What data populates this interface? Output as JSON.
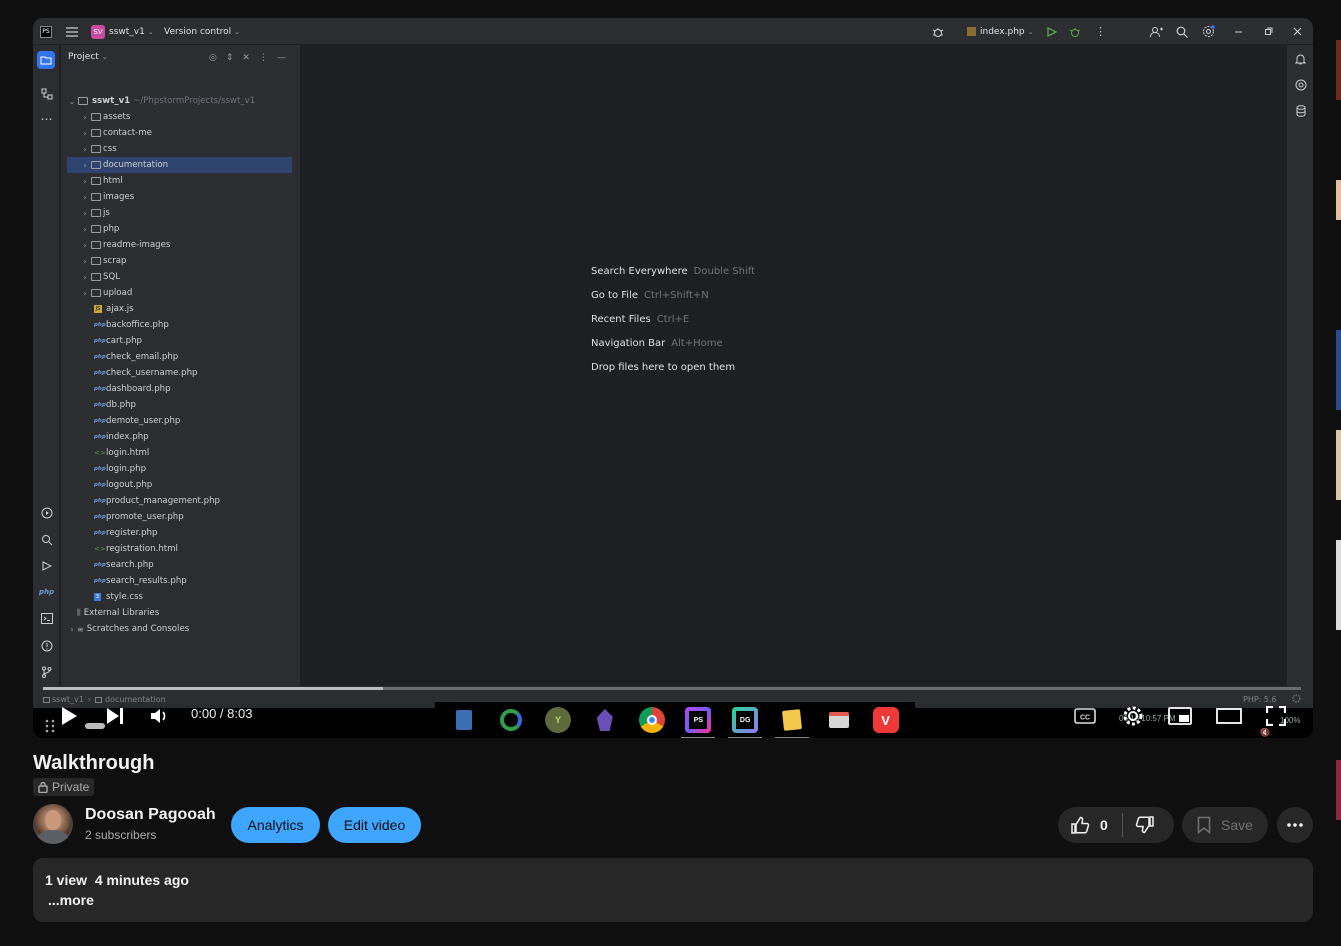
{
  "ide": {
    "project_badge": "SV",
    "project_name": "sswt_v1",
    "vcs_label": "Version control",
    "run_config": "index.php",
    "panel_title": "Project",
    "root_name": "sswt_v1",
    "root_path": "~/PhpstormProjects/sswt_v1",
    "folders": [
      "assets",
      "contact-me",
      "css",
      "documentation",
      "html",
      "images",
      "js",
      "php",
      "readme-images",
      "scrap",
      "SQL",
      "upload"
    ],
    "files": [
      {
        "name": "ajax.js",
        "type": "js"
      },
      {
        "name": "backoffice.php",
        "type": "php"
      },
      {
        "name": "cart.php",
        "type": "php"
      },
      {
        "name": "check_email.php",
        "type": "php"
      },
      {
        "name": "check_username.php",
        "type": "php"
      },
      {
        "name": "dashboard.php",
        "type": "php"
      },
      {
        "name": "db.php",
        "type": "php"
      },
      {
        "name": "demote_user.php",
        "type": "php"
      },
      {
        "name": "index.php",
        "type": "php"
      },
      {
        "name": "login.html",
        "type": "html"
      },
      {
        "name": "login.php",
        "type": "php"
      },
      {
        "name": "logout.php",
        "type": "php"
      },
      {
        "name": "product_management.php",
        "type": "php"
      },
      {
        "name": "promote_user.php",
        "type": "php"
      },
      {
        "name": "register.php",
        "type": "php"
      },
      {
        "name": "registration.html",
        "type": "html"
      },
      {
        "name": "search.php",
        "type": "php"
      },
      {
        "name": "search_results.php",
        "type": "php"
      },
      {
        "name": "style.css",
        "type": "css"
      }
    ],
    "external_libraries": "External Libraries",
    "scratches": "Scratches and Consoles",
    "hints": [
      {
        "label": "Search Everywhere",
        "keys": "Double Shift"
      },
      {
        "label": "Go to File",
        "keys": "Ctrl+Shift+N"
      },
      {
        "label": "Recent Files",
        "keys": "Ctrl+E"
      },
      {
        "label": "Navigation Bar",
        "keys": "Alt+Home"
      },
      {
        "label": "Drop files here to open them",
        "keys": ""
      }
    ],
    "breadcrumb_root": "sswt_v1",
    "breadcrumb_folder": "documentation",
    "php_version": "PHP: 5.6",
    "clock": "06:13 10:57 PM",
    "zoom": "100%"
  },
  "player": {
    "time": "0:00 / 8:03",
    "taskbar_ps": "PS",
    "taskbar_dg": "DG",
    "progress_buffered": 0.27,
    "progress_played": 0
  },
  "video": {
    "title": "Walkthrough",
    "privacy": "Private",
    "channel": "Doosan Pagooah",
    "subscribers": "2 subscribers",
    "analytics": "Analytics",
    "edit": "Edit video",
    "likes": "0",
    "save": "Save",
    "views": "1 view",
    "age": "4 minutes ago",
    "more": "...more"
  },
  "colors": {
    "accent": "#3ea6ff",
    "selection": "#2e436e",
    "progress": "#ff0000"
  }
}
